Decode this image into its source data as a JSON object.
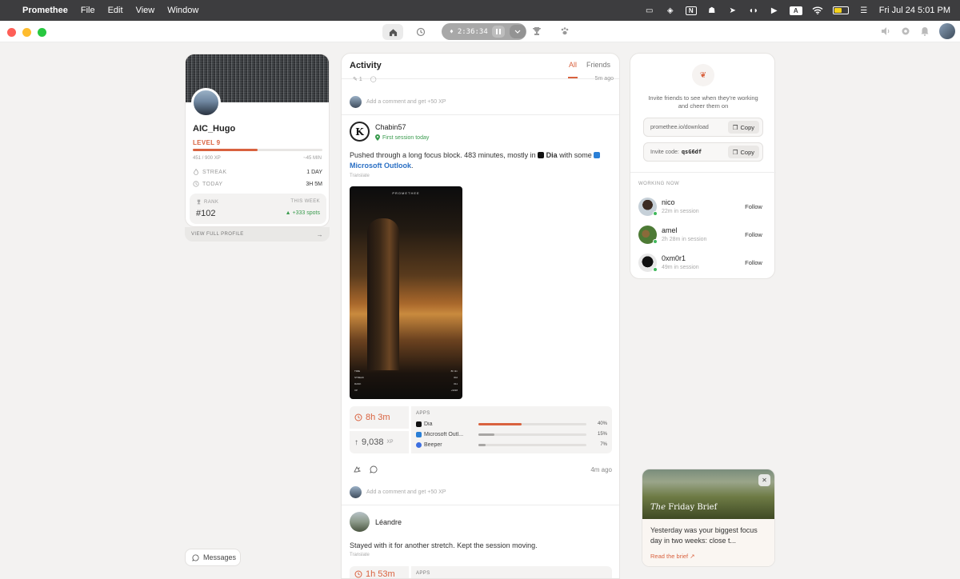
{
  "menubar": {
    "app_name": "Promethee",
    "menus": [
      "File",
      "Edit",
      "View",
      "Window"
    ],
    "status_n": "N",
    "status_a": "A",
    "datetime": "Fri Jul 24  5:01 PM"
  },
  "titlebar": {
    "timer": "2:36:34"
  },
  "profile": {
    "username": "AIC_Hugo",
    "level": "LEVEL 9",
    "xp_progress": 0.5,
    "xp_text": "451 / 900 XP",
    "xp_remaining": "~45 MIN",
    "streak_label": "STREAK",
    "streak_value": "1 DAY",
    "today_label": "TODAY",
    "today_value": "3H 5M",
    "rank_label": "RANK",
    "rank_value": "#102",
    "week_label": "THIS WEEK",
    "week_value": "▲ +333 spots",
    "view_full": "VIEW FULL PROFILE"
  },
  "messages_label": "Messages",
  "feed": {
    "title": "Activity",
    "tab_all": "All",
    "tab_friends": "Friends",
    "peek_count": "1",
    "peek_ago": "5m ago",
    "comment_placeholder": "Add a comment and get +50 XP",
    "post1": {
      "author": "Chabin57",
      "avatar_letter": "K",
      "badge": "First session today",
      "text_before": "Pushed through a long focus block. 483 minutes, mostly in",
      "app_main": "Dia",
      "text_mid": "with some",
      "app_second": "Microsoft Outlook",
      "text_end": ".",
      "translate": "Translate",
      "image_brand": "PROMETHEE",
      "image_stats": [
        {
          "label": "TIME",
          "value": "8h 3m"
        },
        {
          "label": "STREAK",
          "value": "30d"
        },
        {
          "label": "RANK",
          "value": "#11"
        },
        {
          "label": "XP",
          "value": "+9038"
        }
      ],
      "time": "8h 3m",
      "xp": "9,038",
      "xp_unit": "XP",
      "apps_label": "APPS",
      "apps": [
        {
          "name": "Dia",
          "percent": "40%",
          "share": 40,
          "color": "#d9623f",
          "icon_color": "#111111"
        },
        {
          "name": "Microsoft Outl...",
          "percent": "15%",
          "share": 15,
          "color": "#a8a6a4",
          "icon_color": "#2a7fd6"
        },
        {
          "name": "Beeper",
          "percent": "7%",
          "share": 7,
          "color": "#a8a6a4",
          "icon_color": "#3d6fe0"
        }
      ],
      "ago": "4m ago"
    },
    "post2": {
      "author": "Léandre",
      "text": "Stayed with it for another stretch. Kept the session moving.",
      "translate": "Translate",
      "time": "1h 53m",
      "apps_label": "APPS"
    }
  },
  "right": {
    "invite_text": "Invite friends to see when they're working and cheer them on",
    "download_url": "promethee.io/download",
    "invite_label": "Invite code:",
    "invite_code": "qsG6df",
    "copy_label": "Copy",
    "working_now": "WORKING NOW",
    "follow_label": "Follow",
    "workers": [
      {
        "name": "nico",
        "status": "22m in session"
      },
      {
        "name": "amel",
        "status": "2h 28m in session"
      },
      {
        "name": "0xm0r1",
        "status": "49m in session"
      }
    ]
  },
  "brief": {
    "title_prefix": "The",
    "title_main": "Friday Brief",
    "text": "Yesterday was your biggest focus day in two weeks: close t...",
    "link": "Read the brief"
  }
}
